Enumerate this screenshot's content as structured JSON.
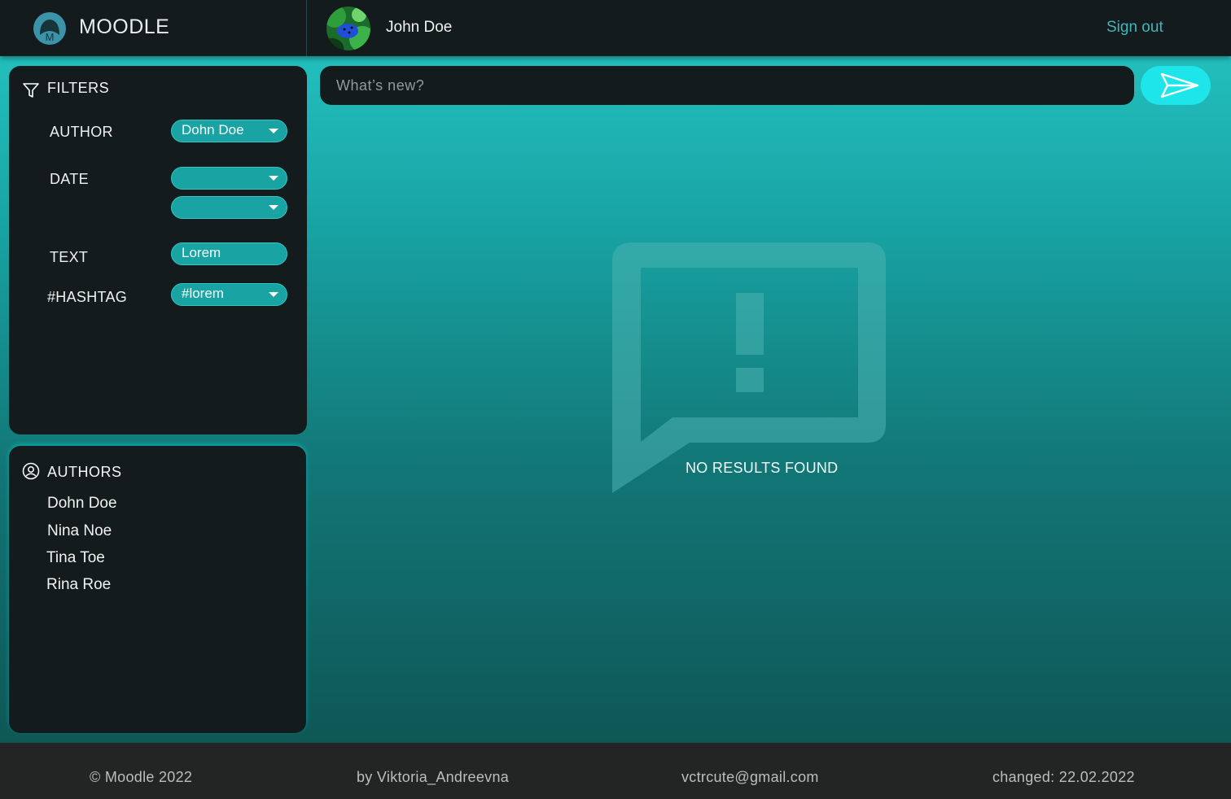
{
  "header": {
    "brand": "MOODLE",
    "user_name": "John Doe",
    "sign_out": "Sign out"
  },
  "filters": {
    "title": "FILTERS",
    "author_label": "AUTHOR",
    "author_value": "Dohn Doe",
    "date_label": "DATE",
    "date_from": "",
    "date_to": "",
    "text_label": "TEXT",
    "text_value": "Lorem",
    "hashtag_label": "#HASHTAG",
    "hashtag_value": "#lorem"
  },
  "authors": {
    "title": "AUTHORS",
    "items": [
      "Dohn Doe",
      "Nina Noe",
      "Tina Toe",
      "Rina Roe"
    ]
  },
  "composer": {
    "placeholder": "What’s  new?"
  },
  "empty_state": {
    "message": "NO RESULTS FOUND"
  },
  "footer": {
    "copyright": "© Moodle 2022",
    "author": "by Viktoria_Andreevna",
    "email": "vctrcute@gmail.com",
    "changed": "changed: 22.02.2022"
  },
  "colors": {
    "accent": "#1ee5ea",
    "dark_panel": "#141b1c",
    "field": "#1aa3a3",
    "link": "#3fb6bd"
  },
  "icons": {
    "logo": "moodle-logo-icon",
    "filter": "filter-icon",
    "authors": "user-circle-icon",
    "send": "send-icon",
    "empty": "message-alert-icon"
  }
}
